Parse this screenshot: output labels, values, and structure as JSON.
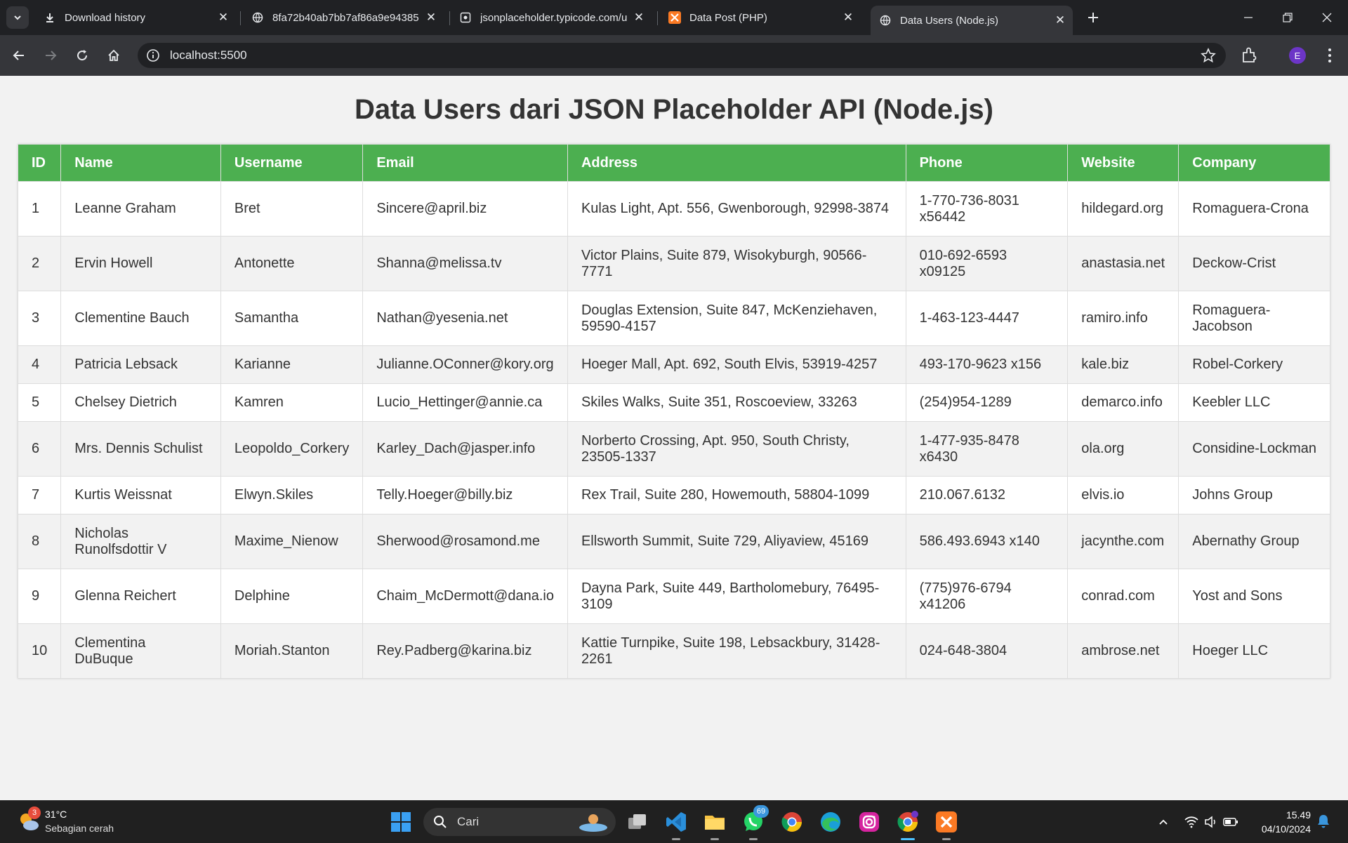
{
  "browser": {
    "tabs": [
      {
        "title": "Download history",
        "icon": "download-icon",
        "active": false
      },
      {
        "title": "8fa72b40ab7bb7af86a9e94385",
        "icon": "globe-icon",
        "active": false
      },
      {
        "title": "jsonplaceholder.typicode.com/u",
        "icon": "github-icon",
        "active": false
      },
      {
        "title": "Data Post (PHP)",
        "icon": "xampp-icon",
        "active": false
      },
      {
        "title": "Data Users (Node.js)",
        "icon": "globe-icon",
        "active": true
      }
    ],
    "url": "localhost:5500",
    "profile_initial": "E"
  },
  "page": {
    "title": "Data Users dari JSON Placeholder API (Node.js)",
    "columns": [
      "ID",
      "Name",
      "Username",
      "Email",
      "Address",
      "Phone",
      "Website",
      "Company"
    ],
    "rows": [
      {
        "id": "1",
        "name": "Leanne Graham",
        "username": "Bret",
        "email": "Sincere@april.biz",
        "address": "Kulas Light, Apt. 556, Gwenborough, 92998-3874",
        "phone": "1-770-736-8031 x56442",
        "website": "hildegard.org",
        "company": "Romaguera-Crona"
      },
      {
        "id": "2",
        "name": "Ervin Howell",
        "username": "Antonette",
        "email": "Shanna@melissa.tv",
        "address": "Victor Plains, Suite 879, Wisokyburgh, 90566-7771",
        "phone": "010-692-6593 x09125",
        "website": "anastasia.net",
        "company": "Deckow-Crist"
      },
      {
        "id": "3",
        "name": "Clementine Bauch",
        "username": "Samantha",
        "email": "Nathan@yesenia.net",
        "address": "Douglas Extension, Suite 847, McKenziehaven, 59590-4157",
        "phone": "1-463-123-4447",
        "website": "ramiro.info",
        "company": "Romaguera-Jacobson"
      },
      {
        "id": "4",
        "name": "Patricia Lebsack",
        "username": "Karianne",
        "email": "Julianne.OConner@kory.org",
        "address": "Hoeger Mall, Apt. 692, South Elvis, 53919-4257",
        "phone": "493-170-9623 x156",
        "website": "kale.biz",
        "company": "Robel-Corkery"
      },
      {
        "id": "5",
        "name": "Chelsey Dietrich",
        "username": "Kamren",
        "email": "Lucio_Hettinger@annie.ca",
        "address": "Skiles Walks, Suite 351, Roscoeview, 33263",
        "phone": "(254)954-1289",
        "website": "demarco.info",
        "company": "Keebler LLC"
      },
      {
        "id": "6",
        "name": "Mrs. Dennis Schulist",
        "username": "Leopoldo_Corkery",
        "email": "Karley_Dach@jasper.info",
        "address": "Norberto Crossing, Apt. 950, South Christy, 23505-1337",
        "phone": "1-477-935-8478 x6430",
        "website": "ola.org",
        "company": "Considine-Lockman"
      },
      {
        "id": "7",
        "name": "Kurtis Weissnat",
        "username": "Elwyn.Skiles",
        "email": "Telly.Hoeger@billy.biz",
        "address": "Rex Trail, Suite 280, Howemouth, 58804-1099",
        "phone": "210.067.6132",
        "website": "elvis.io",
        "company": "Johns Group"
      },
      {
        "id": "8",
        "name": "Nicholas Runolfsdottir V",
        "username": "Maxime_Nienow",
        "email": "Sherwood@rosamond.me",
        "address": "Ellsworth Summit, Suite 729, Aliyaview, 45169",
        "phone": "586.493.6943 x140",
        "website": "jacynthe.com",
        "company": "Abernathy Group"
      },
      {
        "id": "9",
        "name": "Glenna Reichert",
        "username": "Delphine",
        "email": "Chaim_McDermott@dana.io",
        "address": "Dayna Park, Suite 449, Bartholomebury, 76495-3109",
        "phone": "(775)976-6794 x41206",
        "website": "conrad.com",
        "company": "Yost and Sons"
      },
      {
        "id": "10",
        "name": "Clementina DuBuque",
        "username": "Moriah.Stanton",
        "email": "Rey.Padberg@karina.biz",
        "address": "Kattie Turnpike, Suite 198, Lebsackbury, 31428-2261",
        "phone": "024-648-3804",
        "website": "ambrose.net",
        "company": "Hoeger LLC"
      }
    ]
  },
  "taskbar": {
    "weather_temp": "31°C",
    "weather_desc": "Sebagian cerah",
    "weather_badge": "3",
    "search_placeholder": "Cari",
    "apps": [
      "windows-start",
      "search",
      "task-view",
      "vscode",
      "file-explorer",
      "whatsapp",
      "chrome",
      "edge",
      "instagram",
      "chrome-profile",
      "xampp"
    ],
    "whatsapp_badge": "69",
    "time": "15.49",
    "date": "04/10/2024"
  },
  "colors": {
    "header_green": "#4caf50",
    "page_bg": "#f2f2f2",
    "title_text": "#333333",
    "chrome_dark": "#202124",
    "chrome_toolbar": "#35363a",
    "taskbar_bg": "#202020"
  }
}
